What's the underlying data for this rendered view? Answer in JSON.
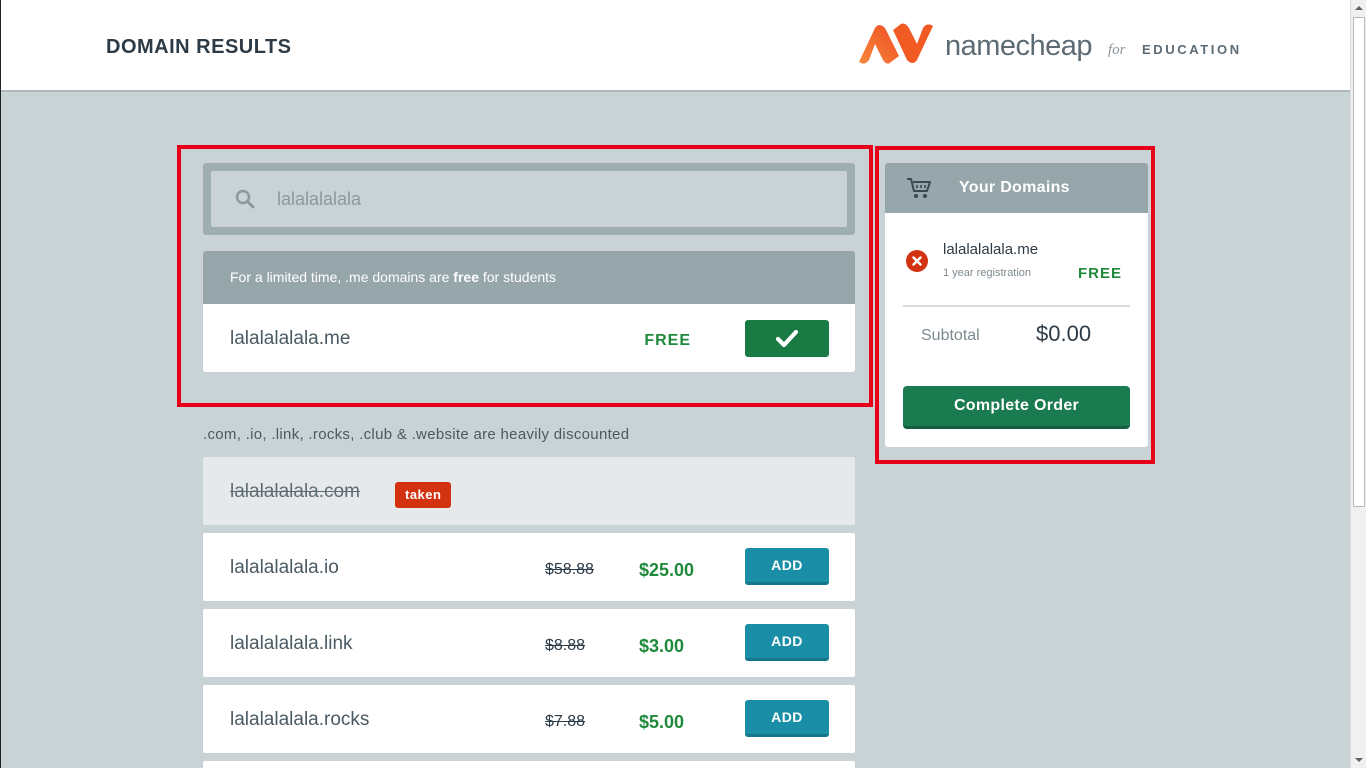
{
  "header": {
    "title": "DOMAIN RESULTS",
    "brand_name": "namecheap",
    "brand_for": "for",
    "brand_edu": "EDUCATION"
  },
  "search": {
    "value": "lalalalalala",
    "icon": "search-icon"
  },
  "promo": {
    "text_before": "For a limited time, .me domains are ",
    "text_bold": "free",
    "text_after": " for students",
    "domain": "lalalalalala.me",
    "price_label": "FREE",
    "select_icon": "checkmark-icon"
  },
  "discount_note": ".com, .io, .link, .rocks, .club & .website are heavily discounted",
  "domains": [
    {
      "name": "lalalalalala.com",
      "status": "taken"
    },
    {
      "name": "lalalalalala.io",
      "old_price": "$58.88",
      "new_price": "$25.00",
      "button": "ADD"
    },
    {
      "name": "lalalalalala.link",
      "old_price": "$8.88",
      "new_price": "$3.00",
      "button": "ADD"
    },
    {
      "name": "lalalalalala.rocks",
      "old_price": "$7.88",
      "new_price": "$5.00",
      "button": "ADD"
    }
  ],
  "cart": {
    "title": "Your Domains",
    "icon": "cart-icon",
    "item": {
      "domain": "lalalalalala.me",
      "term": "1 year registration",
      "price": "FREE",
      "remove_icon": "remove-icon"
    },
    "subtotal_label": "Subtotal",
    "subtotal_value": "$0.00",
    "complete_button": "Complete Order"
  },
  "colors": {
    "background": "#c9d2d4",
    "highlight": "#e8001a",
    "free_green": "#1f8a3b",
    "add_button": "#1a8ea6",
    "confirm_button": "#1a7a50",
    "taken_badge": "#d2320f",
    "brand_orange": "#f15a22"
  }
}
